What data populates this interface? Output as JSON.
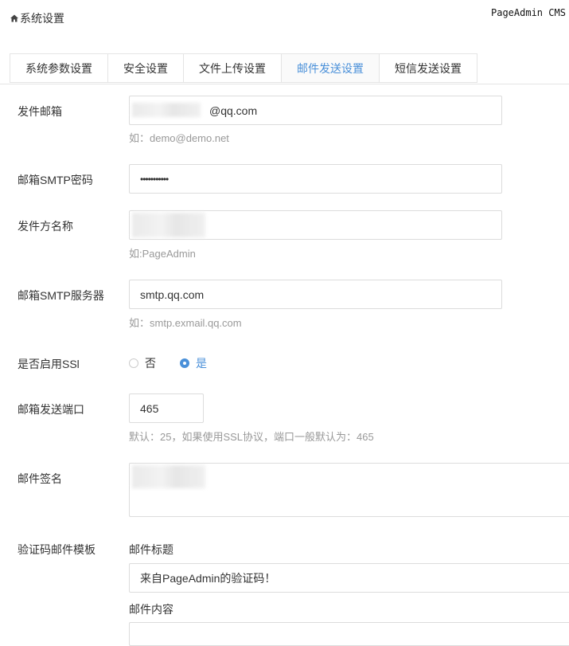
{
  "breadcrumb": {
    "label": "系统设置",
    "icon": "home-icon"
  },
  "brand": "PageAdmin CMS",
  "tabs": [
    {
      "label": "系统参数设置",
      "active": false
    },
    {
      "label": "安全设置",
      "active": false
    },
    {
      "label": "文件上传设置",
      "active": false
    },
    {
      "label": "邮件发送设置",
      "active": true
    },
    {
      "label": "短信发送设置",
      "active": false
    }
  ],
  "form": {
    "sender_email": {
      "label": "发件邮箱",
      "value": "@qq.com",
      "hint": "如：demo@demo.net"
    },
    "smtp_password": {
      "label": "邮箱SMTP密码",
      "value": "•••••••••••"
    },
    "sender_name": {
      "label": "发件方名称",
      "value": "",
      "hint": "如:PageAdmin"
    },
    "smtp_server": {
      "label": "邮箱SMTP服务器",
      "value": "smtp.qq.com",
      "hint": "如：smtp.exmail.qq.com"
    },
    "ssl": {
      "label": "是否启用SSl",
      "options": [
        "否",
        "是"
      ],
      "selected": "是"
    },
    "port": {
      "label": "邮箱发送端口",
      "value": "465",
      "hint": "默认：25，如果使用SSL协议，端口一般默认为：465"
    },
    "signature": {
      "label": "邮件签名",
      "value": ""
    },
    "verify_template": {
      "label": "验证码邮件模板",
      "title_label": "邮件标题",
      "title_value": "来自PageAdmin的验证码！",
      "content_label": "邮件内容"
    }
  },
  "colors": {
    "accent": "#4a90d9",
    "border": "#dcdcdc",
    "hint": "#999999"
  }
}
